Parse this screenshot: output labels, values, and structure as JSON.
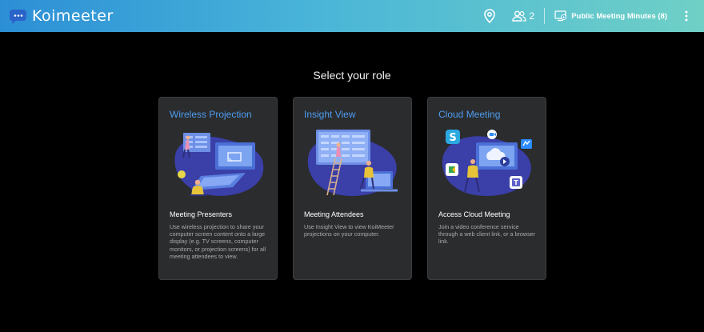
{
  "app": {
    "name": "Koimeeter"
  },
  "header": {
    "participant_count": "2",
    "meeting_title": "Public Meeting Minutes (8)"
  },
  "main": {
    "heading": "Select your role",
    "cards": [
      {
        "title": "Wireless Projection",
        "subtitle": "Meeting Presenters",
        "description": "Use wireless projection to share your computer screen content onto a large display (e.g. TV screens, computer monitors, or projection screens) for all meeting attendees to view."
      },
      {
        "title": "Insight View",
        "subtitle": "Meeting Attendees",
        "description": "Use Insight View to view KoiMeeter projections on your computer."
      },
      {
        "title": "Cloud Meeting",
        "subtitle": "Access Cloud Meeting",
        "description": "Join a video conference service through a web client link, or a browser link."
      }
    ]
  },
  "colors": {
    "header_gradient_start": "#2c8fd6",
    "header_gradient_end": "#6fd0c6",
    "card_title": "#4d9df0",
    "card_background": "#2b2c2e",
    "page_background": "#000000"
  },
  "icons": [
    "koi-logo-icon",
    "location-pin-icon",
    "people-icon",
    "meeting-room-icon",
    "more-vert-icon"
  ]
}
